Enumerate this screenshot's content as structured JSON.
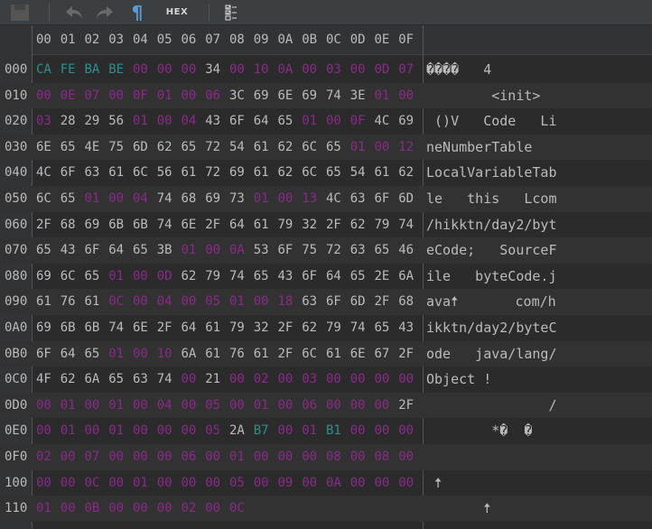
{
  "toolbar": {
    "buttons": [
      {
        "name": "save-icon"
      },
      {
        "name": "undo-icon"
      },
      {
        "name": "redo-icon"
      },
      {
        "name": "pilcrow-icon",
        "glyph": "¶"
      },
      {
        "name": "hex-mode-button",
        "label": "HEX"
      },
      {
        "name": "checklist-icon"
      }
    ]
  },
  "columns": [
    "00",
    "01",
    "02",
    "03",
    "04",
    "05",
    "06",
    "07",
    "08",
    "09",
    "0A",
    "0B",
    "0C",
    "0D",
    "0E",
    "0F"
  ],
  "colors": {
    "normal": "#bbbbbb",
    "zero": "#8a2a8a",
    "magic": "#2d8f8f"
  },
  "rows": [
    {
      "addr": "000",
      "bytes": [
        "CA",
        "FE",
        "BA",
        "BE",
        "00",
        "00",
        "00",
        "34",
        "00",
        "10",
        "0A",
        "00",
        "03",
        "00",
        "0D",
        "07"
      ],
      "ascii": "����   4"
    },
    {
      "addr": "010",
      "bytes": [
        "00",
        "0E",
        "07",
        "00",
        "0F",
        "01",
        "00",
        "06",
        "3C",
        "69",
        "6E",
        "69",
        "74",
        "3E",
        "01",
        "00"
      ],
      "ascii": "        <init>"
    },
    {
      "addr": "020",
      "bytes": [
        "03",
        "28",
        "29",
        "56",
        "01",
        "00",
        "04",
        "43",
        "6F",
        "64",
        "65",
        "01",
        "00",
        "0F",
        "4C",
        "69"
      ],
      "ascii": " ()V   Code   Li"
    },
    {
      "addr": "030",
      "bytes": [
        "6E",
        "65",
        "4E",
        "75",
        "6D",
        "62",
        "65",
        "72",
        "54",
        "61",
        "62",
        "6C",
        "65",
        "01",
        "00",
        "12"
      ],
      "ascii": "neNumberTable"
    },
    {
      "addr": "040",
      "bytes": [
        "4C",
        "6F",
        "63",
        "61",
        "6C",
        "56",
        "61",
        "72",
        "69",
        "61",
        "62",
        "6C",
        "65",
        "54",
        "61",
        "62"
      ],
      "ascii": "LocalVariableTab"
    },
    {
      "addr": "050",
      "bytes": [
        "6C",
        "65",
        "01",
        "00",
        "04",
        "74",
        "68",
        "69",
        "73",
        "01",
        "00",
        "13",
        "4C",
        "63",
        "6F",
        "6D"
      ],
      "ascii": "le   this   Lcom"
    },
    {
      "addr": "060",
      "bytes": [
        "2F",
        "68",
        "69",
        "6B",
        "6B",
        "74",
        "6E",
        "2F",
        "64",
        "61",
        "79",
        "32",
        "2F",
        "62",
        "79",
        "74"
      ],
      "ascii": "/hikktn/day2/byt"
    },
    {
      "addr": "070",
      "bytes": [
        "65",
        "43",
        "6F",
        "64",
        "65",
        "3B",
        "01",
        "00",
        "0A",
        "53",
        "6F",
        "75",
        "72",
        "63",
        "65",
        "46"
      ],
      "ascii": "eCode;   SourceF"
    },
    {
      "addr": "080",
      "bytes": [
        "69",
        "6C",
        "65",
        "01",
        "00",
        "0D",
        "62",
        "79",
        "74",
        "65",
        "43",
        "6F",
        "64",
        "65",
        "2E",
        "6A"
      ],
      "ascii": "ile   byteCode.j"
    },
    {
      "addr": "090",
      "bytes": [
        "61",
        "76",
        "61",
        "0C",
        "00",
        "04",
        "00",
        "05",
        "01",
        "00",
        "18",
        "63",
        "6F",
        "6D",
        "2F",
        "68"
      ],
      "ascii": "ava🠅       com/h"
    },
    {
      "addr": "0A0",
      "bytes": [
        "69",
        "6B",
        "6B",
        "74",
        "6E",
        "2F",
        "64",
        "61",
        "79",
        "32",
        "2F",
        "62",
        "79",
        "74",
        "65",
        "43"
      ],
      "ascii": "ikktn/day2/byteC"
    },
    {
      "addr": "0B0",
      "bytes": [
        "6F",
        "64",
        "65",
        "01",
        "00",
        "10",
        "6A",
        "61",
        "76",
        "61",
        "2F",
        "6C",
        "61",
        "6E",
        "67",
        "2F"
      ],
      "ascii": "ode   java/lang/"
    },
    {
      "addr": "0C0",
      "bytes": [
        "4F",
        "62",
        "6A",
        "65",
        "63",
        "74",
        "00",
        "21",
        "00",
        "02",
        "00",
        "03",
        "00",
        "00",
        "00",
        "00"
      ],
      "ascii": "Object !"
    },
    {
      "addr": "0D0",
      "bytes": [
        "00",
        "01",
        "00",
        "01",
        "00",
        "04",
        "00",
        "05",
        "00",
        "01",
        "00",
        "06",
        "00",
        "00",
        "00",
        "2F"
      ],
      "ascii": "               /"
    },
    {
      "addr": "0E0",
      "bytes": [
        "00",
        "01",
        "00",
        "01",
        "00",
        "00",
        "00",
        "05",
        "2A",
        "B7",
        "00",
        "01",
        "B1",
        "00",
        "00",
        "00"
      ],
      "ascii": "        *�  �"
    },
    {
      "addr": "0F0",
      "bytes": [
        "02",
        "00",
        "07",
        "00",
        "00",
        "00",
        "06",
        "00",
        "01",
        "00",
        "00",
        "00",
        "08",
        "00",
        "08",
        "00"
      ],
      "ascii": ""
    },
    {
      "addr": "100",
      "bytes": [
        "00",
        "00",
        "0C",
        "00",
        "01",
        "00",
        "00",
        "00",
        "05",
        "00",
        "09",
        "00",
        "0A",
        "00",
        "00",
        "00"
      ],
      "ascii": " 🠅"
    },
    {
      "addr": "110",
      "bytes": [
        "01",
        "00",
        "0B",
        "00",
        "00",
        "00",
        "02",
        "00",
        "0C"
      ],
      "ascii": "       🠅"
    }
  ]
}
